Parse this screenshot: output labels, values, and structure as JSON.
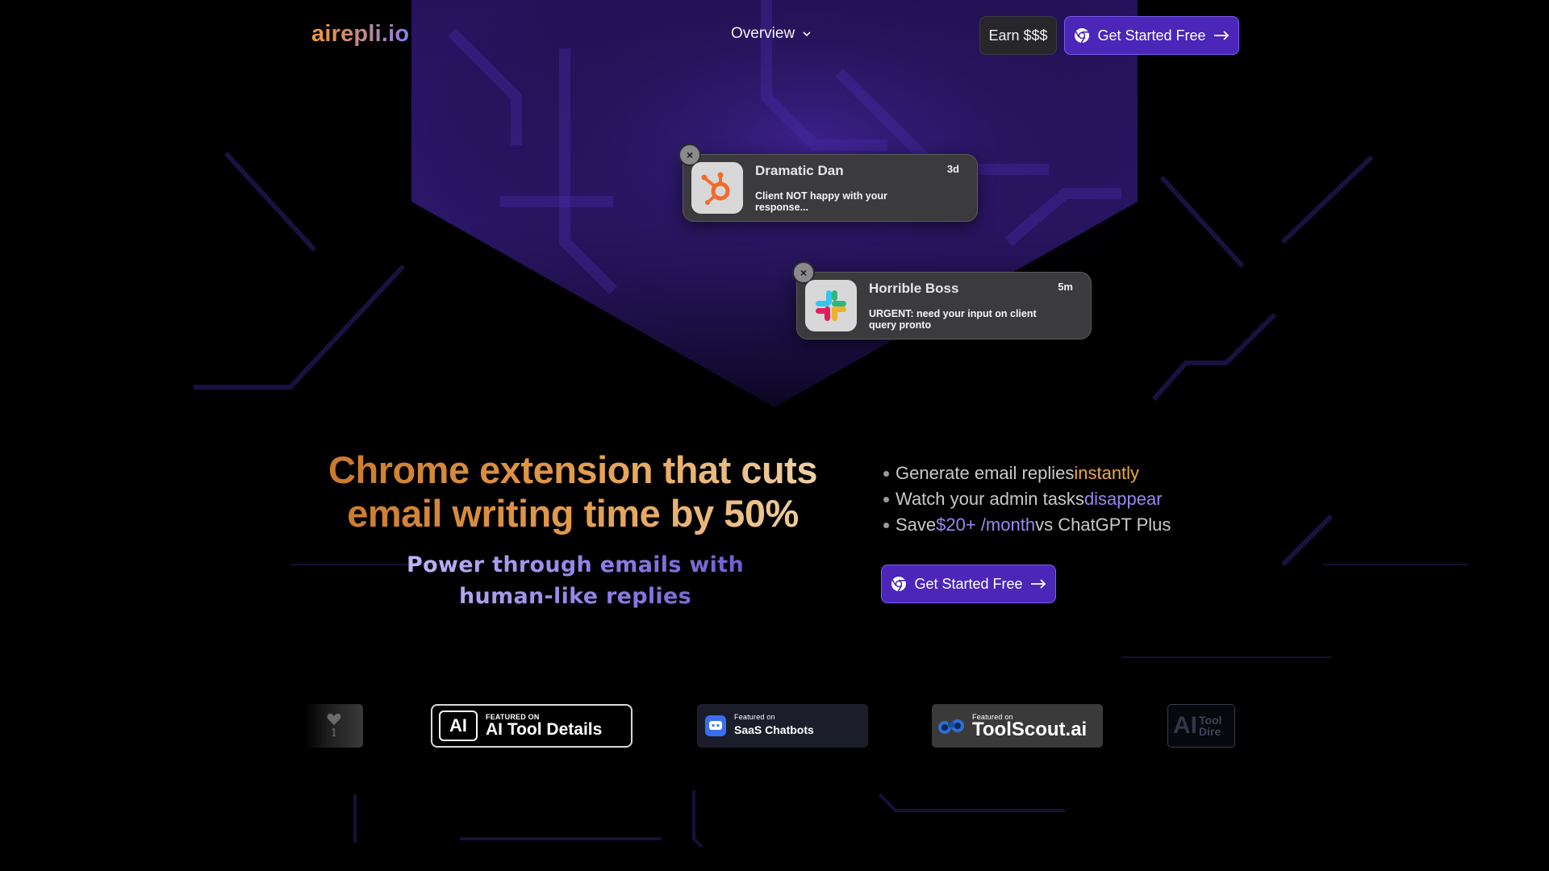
{
  "header": {
    "logo": "airepli.io",
    "nav_overview": "Overview",
    "earn_label": "Earn $$$",
    "cta_label": "Get Started Free"
  },
  "notifications": [
    {
      "name": "Dramatic Dan",
      "time": "3d",
      "message": "Client NOT happy with your response...",
      "app_icon": "hubspot-icon",
      "close": "×"
    },
    {
      "name": "Horrible Boss",
      "time": "5m",
      "message": "URGENT: need your input on client query pronto",
      "app_icon": "slack-icon",
      "close": "×"
    }
  ],
  "hero": {
    "title_line1": "Chrome extension that cuts",
    "title_line2": "email writing time by 50%",
    "subtitle_line1": "Power through emails with",
    "subtitle_line2": "human-like replies",
    "bullets": [
      {
        "prefix": "Generate email replies ",
        "highlight": "instantly",
        "suffix": ""
      },
      {
        "prefix": "Watch your admin tasks ",
        "highlight": "disappear",
        "suffix": ""
      },
      {
        "prefix": "Save ",
        "highlight": "$20+ /month",
        "suffix": " vs ChatGPT Plus"
      }
    ],
    "cta_label": "Get Started Free"
  },
  "featured": {
    "heart_count": "1",
    "ai_tool_details": {
      "small": "FEATURED ON",
      "big": "AI Tool Details"
    },
    "saas_chatbots": {
      "small": "Featured on",
      "big": "SaaS Chatbots"
    },
    "toolscout": {
      "small": "Featured on",
      "big": "ToolScout.ai"
    },
    "ai_tool_directory": {
      "logo": "AI",
      "line1": "Tool",
      "line2": "Dire"
    }
  },
  "colors": {
    "background": "#000000",
    "accent_purple": "#4b26b8",
    "accent_orange": "#f0a93a",
    "highlight_purple": "#9a86f0"
  }
}
